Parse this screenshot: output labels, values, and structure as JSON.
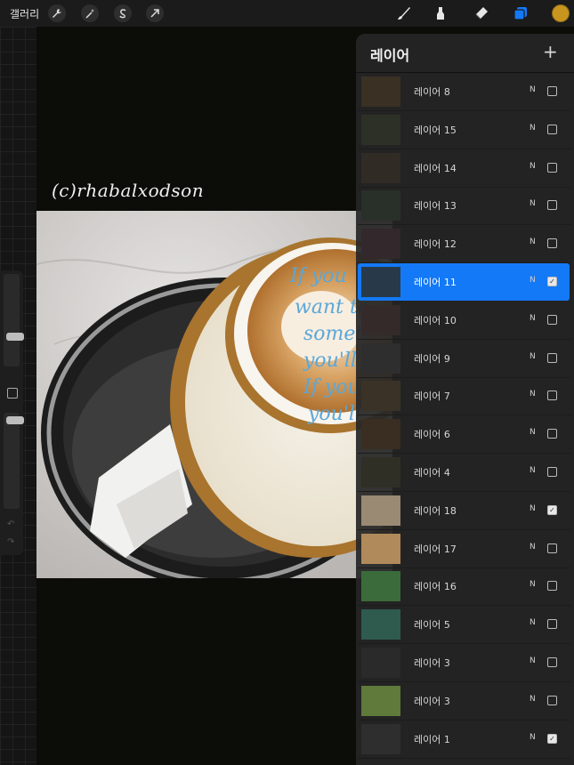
{
  "topbar": {
    "gallery_label": "갤러리",
    "left_tools": [
      "wrench-icon",
      "magic-wand-icon",
      "selection-s-icon",
      "transform-arrow-icon"
    ],
    "right_tools": [
      "brush-icon",
      "smudge-icon",
      "eraser-icon",
      "layers-icon"
    ],
    "active_color": "#c8951e"
  },
  "canvas": {
    "watermark": "(c)rhabalxodson",
    "background": "#0c0c08"
  },
  "layers_panel": {
    "title": "레이어",
    "add_label": "+",
    "accent": "#1479f6",
    "layers": [
      {
        "name": "레이어 8",
        "blend": "N",
        "visible": false,
        "selected": false,
        "thumb": "#3a3024"
      },
      {
        "name": "레이어 15",
        "blend": "N",
        "visible": false,
        "selected": false,
        "thumb": "#2c3026"
      },
      {
        "name": "레이어 14",
        "blend": "N",
        "visible": false,
        "selected": false,
        "thumb": "#302b24"
      },
      {
        "name": "레이어 13",
        "blend": "N",
        "visible": false,
        "selected": false,
        "thumb": "#29302a"
      },
      {
        "name": "레이어 12",
        "blend": "N",
        "visible": false,
        "selected": false,
        "thumb": "#33282c"
      },
      {
        "name": "레이어 11",
        "blend": "N",
        "visible": true,
        "selected": true,
        "thumb": "#283a4a"
      },
      {
        "name": "레이어 10",
        "blend": "N",
        "visible": false,
        "selected": false,
        "thumb": "#342a2a"
      },
      {
        "name": "레이어 9",
        "blend": "N",
        "visible": false,
        "selected": false,
        "thumb": "#2e2e2e"
      },
      {
        "name": "레이어 7",
        "blend": "N",
        "visible": false,
        "selected": false,
        "thumb": "#3a3226"
      },
      {
        "name": "레이어 6",
        "blend": "N",
        "visible": false,
        "selected": false,
        "thumb": "#3a2e22"
      },
      {
        "name": "레이어 4",
        "blend": "N",
        "visible": false,
        "selected": false,
        "thumb": "#2f2f26"
      },
      {
        "name": "레이어 18",
        "blend": "N",
        "visible": true,
        "selected": false,
        "thumb": "#9a8a74"
      },
      {
        "name": "레이어 17",
        "blend": "N",
        "visible": false,
        "selected": false,
        "thumb": "#b08a5a"
      },
      {
        "name": "레이어 16",
        "blend": "N",
        "visible": false,
        "selected": false,
        "thumb": "#3b6b3a"
      },
      {
        "name": "레이어 5",
        "blend": "N",
        "visible": false,
        "selected": false,
        "thumb": "#2f5a4e"
      },
      {
        "name": "레이어 3",
        "blend": "N",
        "visible": false,
        "selected": false,
        "thumb": "#2a2a2a"
      },
      {
        "name": "레이어 3",
        "blend": "N",
        "visible": false,
        "selected": false,
        "thumb": "#5f7a3a"
      },
      {
        "name": "레이어 1",
        "blend": "N",
        "visible": true,
        "selected": false,
        "thumb": "#2e2e2e"
      }
    ]
  }
}
